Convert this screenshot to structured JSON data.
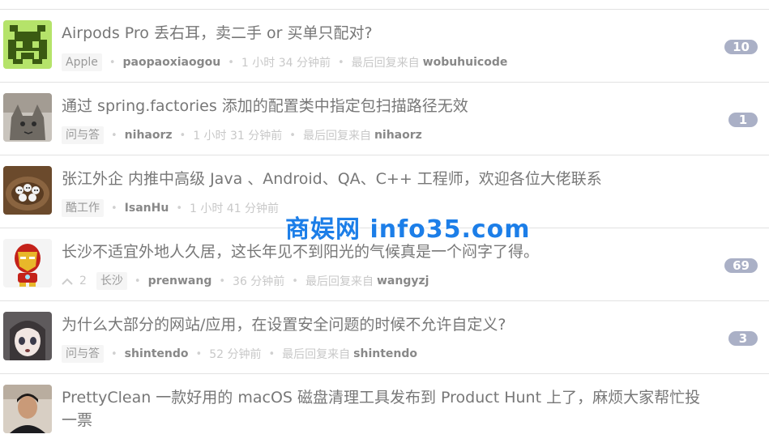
{
  "topics": [
    {
      "title": "Airpods Pro 丢右耳，卖二手 or 买单只配对?",
      "node": "Apple",
      "author": "paopaoxiaogou",
      "time": "1 小时 34 分钟前",
      "last_reply_label": "最后回复来自",
      "last_reply_user": "wobuhuicode",
      "reply_count": "10"
    },
    {
      "title": "通过 spring.factories 添加的配置类中指定包扫描路径无效",
      "node": "问与答",
      "author": "nihaorz",
      "time": "1 小时 31 分钟前",
      "last_reply_label": "最后回复来自",
      "last_reply_user": "nihaorz",
      "reply_count": "1"
    },
    {
      "title": "张江外企 内推中高级 Java 、Android、QA、C++ 工程师，欢迎各位大佬联系",
      "node": "酷工作",
      "author": "IsanHu",
      "time": "1 小时 41 分钟前"
    },
    {
      "title": "长沙不适宜外地人久居，这长年见不到阳光的气候真是一个闷字了得。",
      "votes": "2",
      "node": "长沙",
      "author": "prenwang",
      "time": "36 分钟前",
      "last_reply_label": "最后回复来自",
      "last_reply_user": "wangyzj",
      "reply_count": "69"
    },
    {
      "title": "为什么大部分的网站/应用，在设置安全问题的时候不允许自定义?",
      "node": "问与答",
      "author": "shintendo",
      "time": "52 分钟前",
      "last_reply_label": "最后回复来自",
      "last_reply_user": "shintendo",
      "reply_count": "3"
    },
    {
      "title": "PrettyClean 一款好用的 macOS 磁盘清理工具发布到 Product Hunt 上了，麻烦大家帮忙投一票"
    }
  ],
  "watermark": "商娱网 info35.com"
}
